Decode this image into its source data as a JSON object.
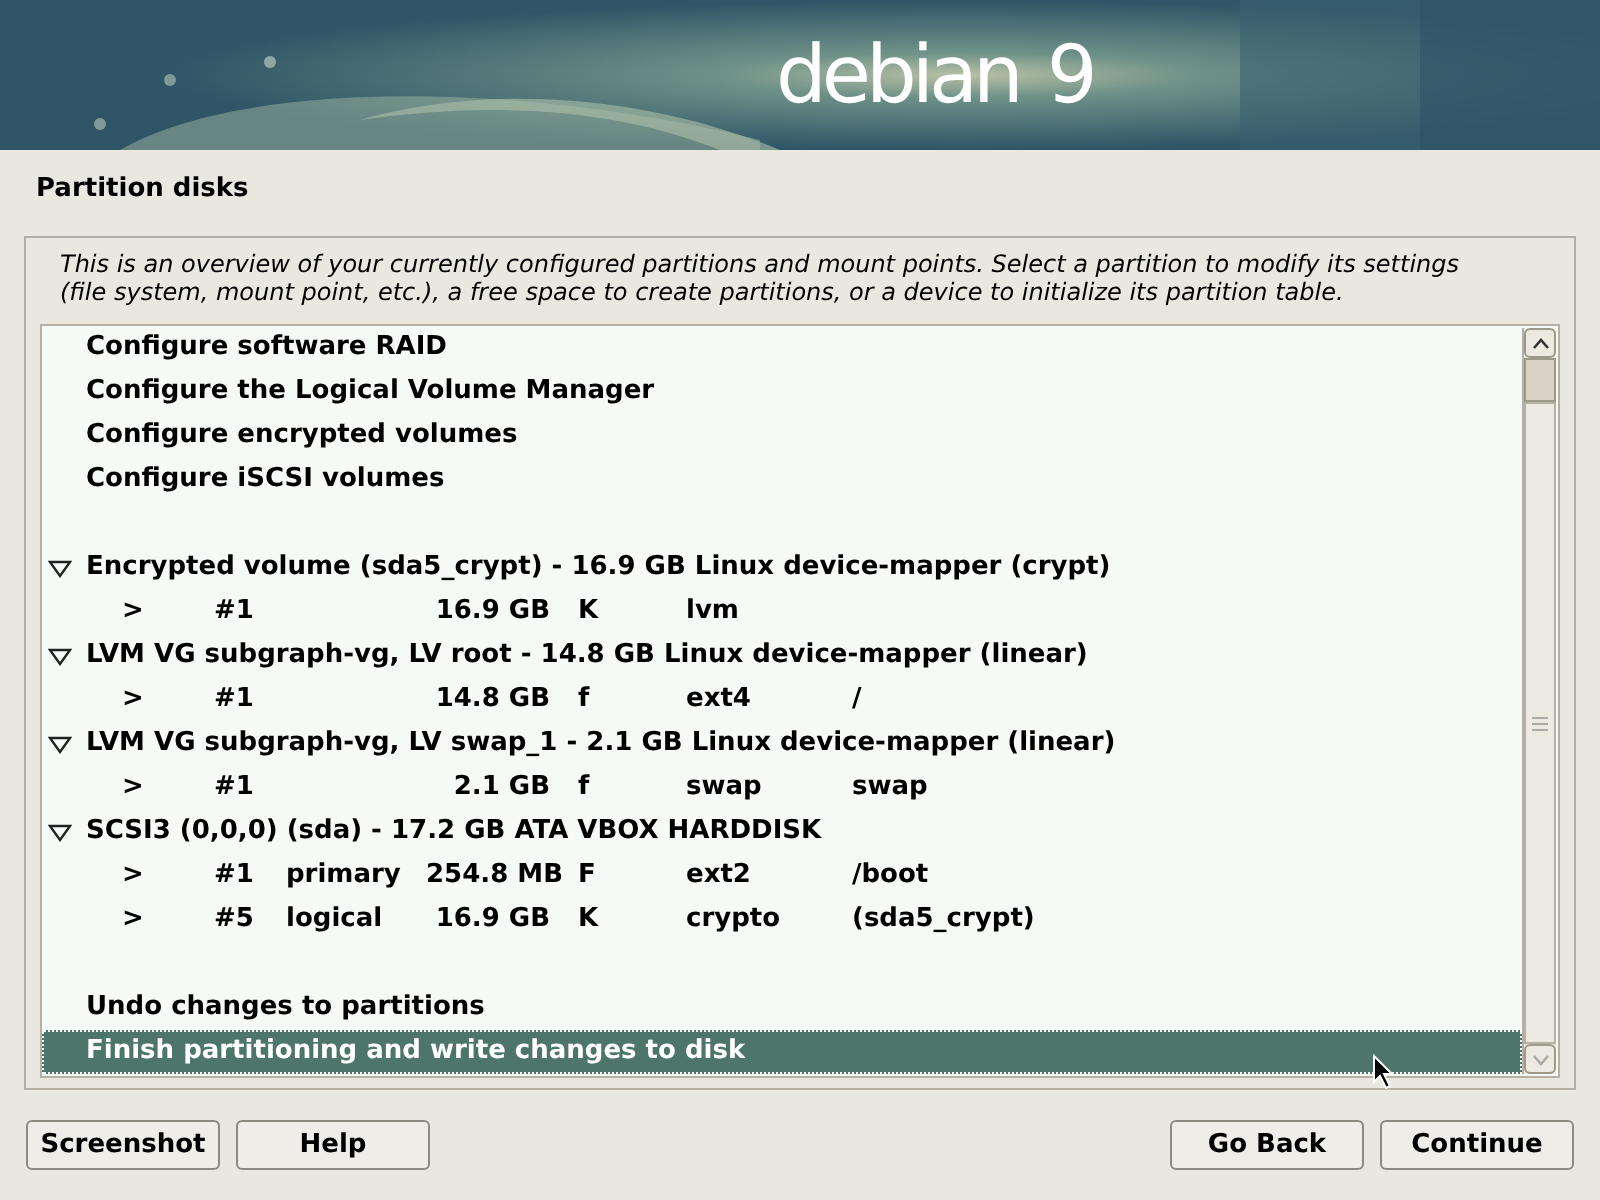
{
  "banner": {
    "logo": "debian",
    "version": "9"
  },
  "title": "Partition disks",
  "description": "This is an overview of your currently configured partitions and mount points. Select a partition to modify its settings (file system, mount point, etc.), a free space to create partitions, or a device to initialize its partition table.",
  "list": [
    {
      "kind": "action",
      "label": "Configure software RAID",
      "selected": false
    },
    {
      "kind": "action",
      "label": "Configure the Logical Volume Manager",
      "selected": false
    },
    {
      "kind": "action",
      "label": "Configure encrypted volumes",
      "selected": false
    },
    {
      "kind": "action",
      "label": "Configure iSCSI volumes",
      "selected": false
    },
    {
      "kind": "blank"
    },
    {
      "kind": "device",
      "label": "Encrypted volume (sda5_crypt) - 16.9 GB Linux device-mapper (crypt)",
      "expanded": true,
      "selected": false,
      "children": [
        {
          "arrow": ">",
          "number": "#1",
          "size": "16.9 GB",
          "flag": "K",
          "fs": "lvm",
          "selected": false
        }
      ]
    },
    {
      "kind": "device",
      "label": "LVM VG subgraph-vg, LV root - 14.8 GB Linux device-mapper (linear)",
      "expanded": true,
      "selected": false,
      "children": [
        {
          "arrow": ">",
          "number": "#1",
          "size": "14.8 GB",
          "flag": "f",
          "fs": "ext4",
          "mount": "/",
          "selected": false
        }
      ]
    },
    {
      "kind": "device",
      "label": "LVM VG subgraph-vg, LV swap_1 - 2.1 GB Linux device-mapper (linear)",
      "expanded": true,
      "selected": false,
      "children": [
        {
          "arrow": ">",
          "number": "#1",
          "size": "2.1 GB",
          "flag": "f",
          "fs": "swap",
          "mount": "swap",
          "selected": false
        }
      ]
    },
    {
      "kind": "device",
      "label": "SCSI3 (0,0,0) (sda) - 17.2 GB ATA VBOX HARDDISK",
      "expanded": true,
      "selected": false,
      "children": [
        {
          "arrow": ">",
          "number": "#1",
          "type": "primary",
          "size": "254.8 MB",
          "flag": "F",
          "fs": "ext2",
          "mount": "/boot",
          "selected": false
        },
        {
          "arrow": ">",
          "number": "#5",
          "type": "logical",
          "size": "16.9 GB",
          "flag": "K",
          "fs": "crypto",
          "mount": "(sda5_crypt)",
          "selected": false
        }
      ]
    },
    {
      "kind": "blank"
    },
    {
      "kind": "action",
      "label": "Undo changes to partitions",
      "selected": false
    },
    {
      "kind": "action",
      "label": "Finish partitioning and write changes to disk",
      "selected": true
    }
  ],
  "buttons_left": [
    "Screenshot",
    "Help"
  ],
  "buttons_right": [
    "Go Back",
    "Continue"
  ]
}
